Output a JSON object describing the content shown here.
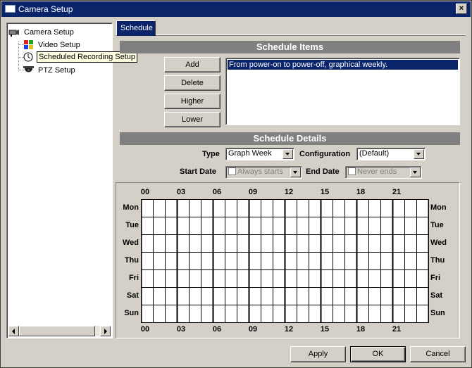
{
  "window": {
    "title": "Camera Setup",
    "close_label": "×"
  },
  "tree": {
    "root": {
      "label": "Camera Setup",
      "icon": "camera-icon"
    },
    "items": [
      {
        "label": "Video Setup",
        "icon": "video-icon"
      },
      {
        "label": "Scheduled Recording Setup",
        "icon": "clock-icon"
      },
      {
        "label": "PTZ Setup",
        "icon": "ptz-camera-icon"
      }
    ]
  },
  "tabs": [
    {
      "label": "Schedule"
    }
  ],
  "schedule_items": {
    "header": "Schedule Items",
    "buttons": {
      "add": "Add",
      "delete": "Delete",
      "higher": "Higher",
      "lower": "Lower"
    },
    "list": [
      "From power-on to power-off, graphical weekly."
    ]
  },
  "schedule_details": {
    "header": "Schedule Details",
    "type_label": "Type",
    "type_value": "Graph Week",
    "config_label": "Configuration",
    "config_value": "(Default)",
    "start_label": "Start Date",
    "start_value": "Always starts",
    "end_label": "End Date",
    "end_value": "Never ends"
  },
  "grid": {
    "hours": [
      "00",
      "03",
      "06",
      "09",
      "12",
      "15",
      "18",
      "21"
    ],
    "days": [
      "Mon",
      "Tue",
      "Wed",
      "Thu",
      "Fri",
      "Sat",
      "Sun"
    ],
    "columns": 24
  },
  "footer": {
    "apply": "Apply",
    "ok": "OK",
    "cancel": "Cancel"
  },
  "colors": {
    "titlebar": "#0a246a",
    "selection": "#0a246a",
    "section_header": "#808080",
    "face": "#d4d0c8"
  }
}
